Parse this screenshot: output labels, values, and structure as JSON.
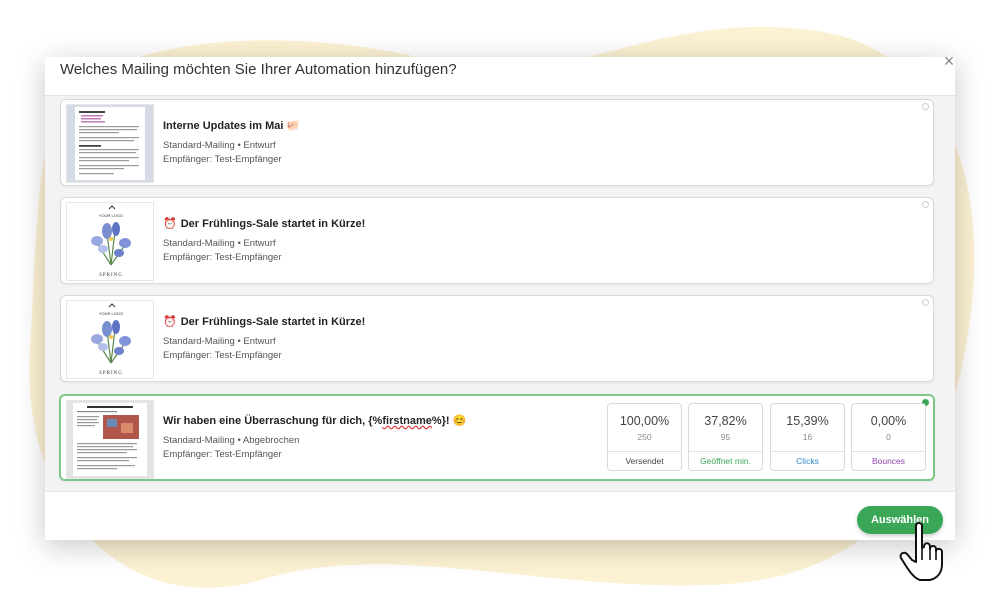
{
  "dialog": {
    "title": "Welches Mailing möchten Sie Ihrer Automation hinzufügen?",
    "close_icon": "close-icon"
  },
  "mailings": [
    {
      "title": "Interne Updates im Mai",
      "emoji": "🐖",
      "type": "Standard-Mailing • Entwurf",
      "recipient": "Empfänger: Test-Empfänger",
      "thumbnail": "newsletter-text-thumbnail"
    },
    {
      "emoji_prefix": "⏰",
      "title": "Der Frühlings-Sale startet in Kürze!",
      "type": "Standard-Mailing • Entwurf",
      "recipient": "Empfänger: Test-Empfänger",
      "thumbnail_logo": "YOUR LOGO",
      "thumbnail_caption": "SPRING"
    },
    {
      "emoji_prefix": "⏰",
      "title": "Der Frühlings-Sale startet in Kürze!",
      "type": "Standard-Mailing • Entwurf",
      "recipient": "Empfänger: Test-Empfänger",
      "thumbnail_logo": "YOUR LOGO",
      "thumbnail_caption": "SPRING"
    },
    {
      "title_prefix": "Wir haben eine Überraschung für dich, {%",
      "title_placeholder": "firstname",
      "title_suffix": "%}!",
      "emoji": "😊",
      "type": "Standard-Mailing • Abgebrochen",
      "recipient": "Empfänger: Test-Empfänger",
      "thumbnail": "newsletter-image-thumbnail",
      "selected": true,
      "stats": [
        {
          "percent": "100,00%",
          "count": "250",
          "label": "Versendet",
          "color": "#444444"
        },
        {
          "percent": "37,82%",
          "count": "95",
          "label": "Geöffnet min.",
          "color": "#3aa757"
        },
        {
          "percent": "15,39%",
          "count": "16",
          "label": "Clicks",
          "color": "#2f86c9"
        },
        {
          "percent": "0,00%",
          "count": "0",
          "label": "Bounces",
          "color": "#8e44ad"
        }
      ]
    }
  ],
  "footer": {
    "select_label": "Auswählen"
  },
  "colors": {
    "accent": "#3aa757",
    "selected_border": "#7cc987",
    "background_blob": "#fdf1d3"
  },
  "cursor_icon": "hand-pointer-icon"
}
